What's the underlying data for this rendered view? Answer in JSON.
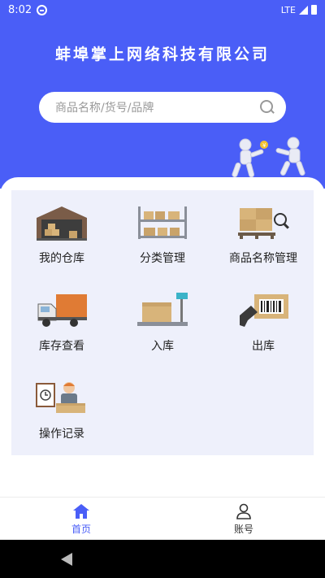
{
  "statusbar": {
    "time": "8:02",
    "network": "LTE"
  },
  "header": {
    "title": "蚌埠掌上网络科技有限公司"
  },
  "search": {
    "placeholder": "商品名称/货号/品牌"
  },
  "menu": [
    {
      "label": "我的仓库",
      "icon": "warehouse-icon"
    },
    {
      "label": "分类管理",
      "icon": "shelf-icon"
    },
    {
      "label": "商品名称管理",
      "icon": "pallet-scan-icon"
    },
    {
      "label": "库存查看",
      "icon": "truck-icon"
    },
    {
      "label": "入库",
      "icon": "scale-box-icon"
    },
    {
      "label": "出库",
      "icon": "barcode-scanner-icon"
    },
    {
      "label": "操作记录",
      "icon": "clipboard-worker-icon"
    }
  ],
  "bottom_nav": [
    {
      "label": "首页",
      "icon": "home-icon",
      "active": true
    },
    {
      "label": "账号",
      "icon": "user-icon",
      "active": false
    }
  ],
  "colors": {
    "primary": "#4a5ef7",
    "grid_bg": "#eef0fb"
  }
}
